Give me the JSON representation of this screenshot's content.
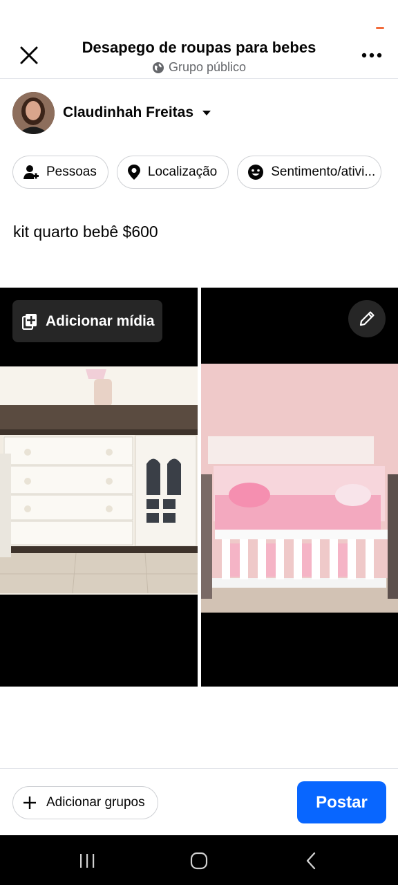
{
  "header": {
    "title": "Desapego de roupas para bebes",
    "subtitle": "Grupo público",
    "close_icon": "close-icon",
    "more_icon": "more-horizontal-icon"
  },
  "author": {
    "name": "Claudinhah Freitas",
    "dropdown_icon": "caret-down-icon"
  },
  "chips": [
    {
      "label": "Pessoas",
      "icon": "tag-people-icon"
    },
    {
      "label": "Localização",
      "icon": "location-pin-icon"
    },
    {
      "label": "Sentimento/ativi...",
      "icon": "smiley-icon"
    }
  ],
  "post": {
    "text": "kit quarto bebê $600"
  },
  "media": {
    "add_media_label": "Adicionar mídia",
    "photos": [
      "dresser-photo",
      "crib-photo"
    ]
  },
  "footer": {
    "add_groups_label": "Adicionar grupos",
    "post_label": "Postar"
  },
  "colors": {
    "accent": "#0866ff",
    "secondary_text": "#65676b",
    "border": "#ced0d4"
  }
}
